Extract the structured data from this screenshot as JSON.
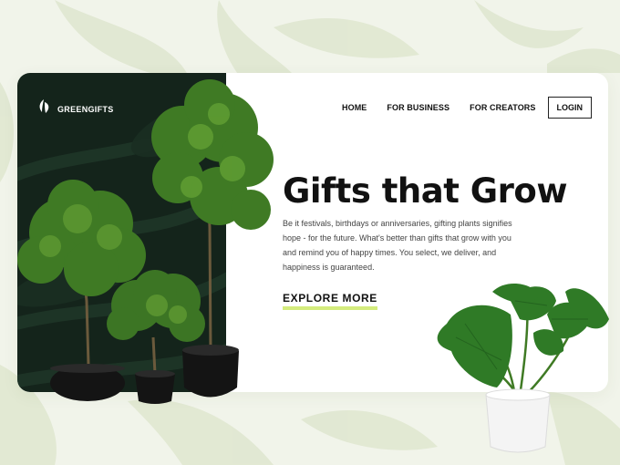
{
  "brand": {
    "name": "GREENGIFTS",
    "icon": "leaf-icon"
  },
  "nav": {
    "items": [
      {
        "label": "HOME"
      },
      {
        "label": "FOR BUSINESS"
      },
      {
        "label": "FOR CREATORS"
      }
    ],
    "login_label": "LOGIN"
  },
  "hero": {
    "title": "Gifts that Grow",
    "description_lines": [
      "Be it festivals, birthdays or anniversaries, gifting plants signifies",
      "hope - for the future. What's better than gifts that grow with you",
      "and remind you of happy times. You select, we deliver, and",
      "happiness is guaranteed."
    ],
    "cta_label": "EXPLORE MORE"
  },
  "colors": {
    "background": "#f1f4ea",
    "dark_panel": "#14241b",
    "accent_underline": "#d4ec7d",
    "foliage": "#3f7a24",
    "pot_black": "#141414",
    "pot_white": "#f4f4f4"
  }
}
